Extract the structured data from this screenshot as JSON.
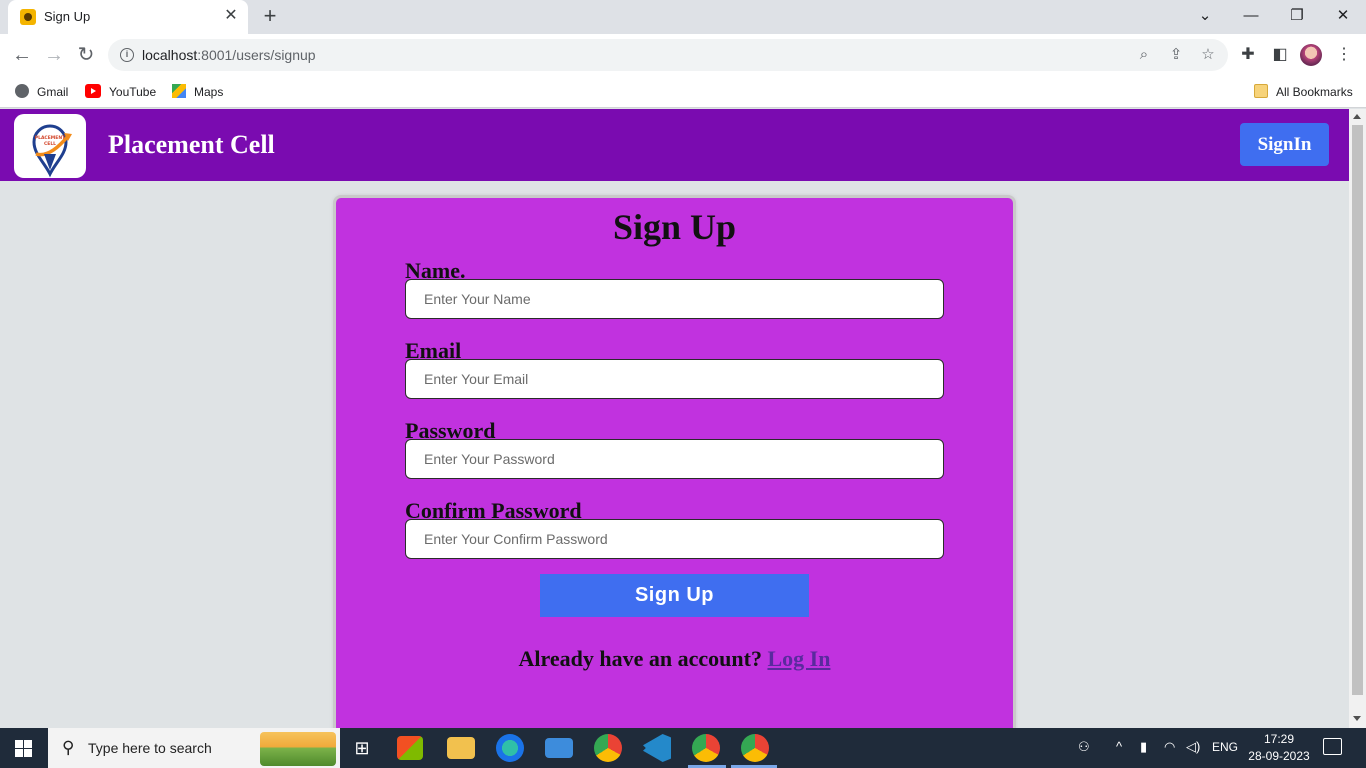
{
  "browser": {
    "tab_title": "Sign Up",
    "tab_close": "✕",
    "new_tab": "+",
    "url_host": "localhost",
    "url_path": ":8001/users/signup",
    "bookmarks": [
      {
        "label": "Gmail",
        "icon": "gmail-icon"
      },
      {
        "label": "YouTube",
        "icon": "youtube-icon"
      },
      {
        "label": "Maps",
        "icon": "maps-icon"
      }
    ],
    "all_bookmarks": "All Bookmarks"
  },
  "navbar": {
    "brand": "Placement Cell",
    "signin_label": "SignIn",
    "logo_text": "PLACEMENT CELL",
    "color": "#7a0bb0"
  },
  "form": {
    "title": "Sign Up",
    "fields": [
      {
        "label": "Name.",
        "placeholder": "Enter Your Name",
        "value": ""
      },
      {
        "label": "Email",
        "placeholder": "Enter Your Email",
        "value": ""
      },
      {
        "label": "Password",
        "placeholder": "Enter Your Password",
        "value": ""
      },
      {
        "label": "Confirm Password",
        "placeholder": "Enter Your Confirm Password",
        "value": ""
      }
    ],
    "submit_label": "Sign Up",
    "account_prompt": "Already have an account?",
    "login_link": "Log In",
    "card_color": "#c132df",
    "button_color": "#3f6ef0"
  },
  "taskbar": {
    "search_placeholder": "Type here to search",
    "language": "ENG",
    "time": "17:29",
    "date": "28-09-2023"
  }
}
